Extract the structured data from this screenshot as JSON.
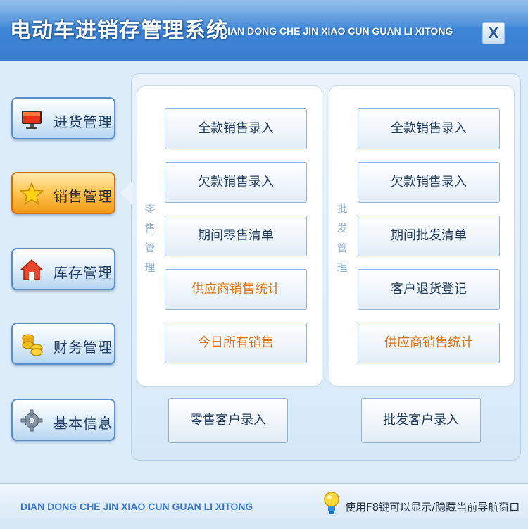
{
  "window": {
    "title": "电动车进销存管理系统",
    "pinyin": "DIAN DONG CHE JIN XIAO CUN GUAN LI XITONG",
    "close_label": "X"
  },
  "nav": {
    "items": [
      {
        "label": "进货管理",
        "icon": "monitor-icon",
        "active": false
      },
      {
        "label": "销售管理",
        "icon": "star-icon",
        "active": true
      },
      {
        "label": "库存管理",
        "icon": "house-icon",
        "active": false
      },
      {
        "label": "财务管理",
        "icon": "coins-icon",
        "active": false
      },
      {
        "label": "基本信息",
        "icon": "gear-icon",
        "active": false
      }
    ]
  },
  "retail": {
    "label_chars": [
      "零",
      "售",
      "管",
      "理"
    ],
    "buttons": [
      "全款销售录入",
      "欠款销售录入",
      "期间零售清单",
      "供应商销售统计",
      "今日所有销售"
    ]
  },
  "wholesale": {
    "label_chars": [
      "批",
      "发",
      "管",
      "理"
    ],
    "buttons": [
      "全款销售录入",
      "欠款销售录入",
      "期间批发清单",
      "客户退货登记",
      "供应商销售统计"
    ]
  },
  "bottom_buttons": {
    "retail_customer": "零售客户录入",
    "wholesale_customer": "批发客户录入"
  },
  "footer": {
    "pinyin": "DIAN DONG CHE JIN XIAO CUN GUAN LI XITONG",
    "hint": "使用F8键可以显示/隐藏当前导航窗口"
  },
  "colors": {
    "title_bar": "#3f86d6",
    "active_nav": "#f29a16",
    "highlight_text": "#e07410",
    "footer_text": "#3a7acc"
  }
}
